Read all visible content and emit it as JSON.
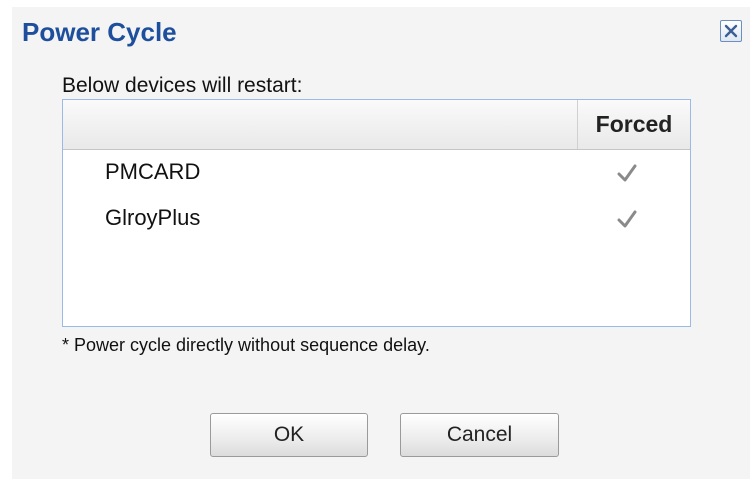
{
  "dialog": {
    "title": "Power Cycle",
    "close_icon": "close-icon",
    "intro": "Below devices will restart:",
    "grid": {
      "columns": [
        "",
        "Forced"
      ],
      "rows": [
        {
          "name": "PMCARD",
          "forced": true
        },
        {
          "name": "GlroyPlus",
          "forced": true
        }
      ]
    },
    "note": "* Power cycle directly without sequence delay.",
    "buttons": {
      "ok": "OK",
      "cancel": "Cancel"
    }
  },
  "colors": {
    "title": "#1d4f9c",
    "dialog_bg": "#f4f4f4",
    "grid_border": "#99bbe8",
    "check_disabled": "#8a8a8a"
  }
}
